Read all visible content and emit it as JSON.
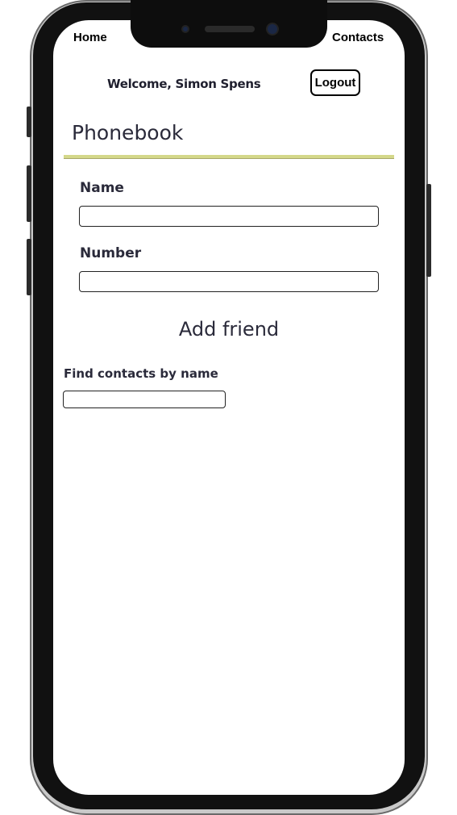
{
  "nav": {
    "home_label": "Home",
    "contacts_label": "Contacts"
  },
  "user_menu": {
    "welcome_text": "Welcome, Simon Spens",
    "logout_label": "Logout"
  },
  "phonebook": {
    "title": "Phonebook",
    "name_label": "Name",
    "name_value": "",
    "number_label": "Number",
    "number_value": "",
    "add_button_label": "Add friend"
  },
  "filter": {
    "label": "Find contacts by name",
    "value": ""
  },
  "colors": {
    "title_rule": "#d4d88a",
    "text": "#2a2a3a"
  }
}
